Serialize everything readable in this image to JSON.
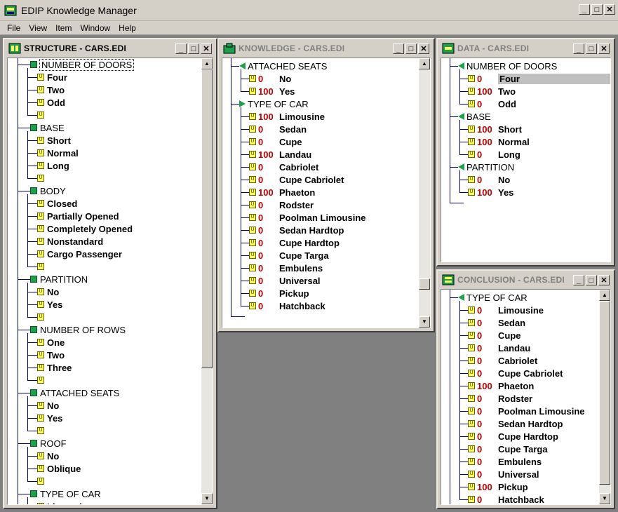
{
  "app": {
    "title": "EDIP Knowledge Manager",
    "menu": [
      "File",
      "View",
      "Item",
      "Window",
      "Help"
    ]
  },
  "structure": {
    "title": "STRUCTURE - CARS.EDI",
    "items": [
      {
        "kind": "group",
        "label": "NUMBER OF DOORS"
      },
      {
        "kind": "value",
        "label": "Four"
      },
      {
        "kind": "value",
        "label": "Two"
      },
      {
        "kind": "value",
        "label": "Odd"
      },
      {
        "kind": "value",
        "label": ""
      },
      {
        "kind": "group",
        "label": "BASE"
      },
      {
        "kind": "value",
        "label": "Short"
      },
      {
        "kind": "value",
        "label": "Normal"
      },
      {
        "kind": "value",
        "label": "Long"
      },
      {
        "kind": "value",
        "label": ""
      },
      {
        "kind": "group",
        "label": "BODY"
      },
      {
        "kind": "value",
        "label": "Closed"
      },
      {
        "kind": "value",
        "label": "Partially Opened"
      },
      {
        "kind": "value",
        "label": "Completely Opened"
      },
      {
        "kind": "value",
        "label": "Nonstandard"
      },
      {
        "kind": "value",
        "label": "Cargo Passenger"
      },
      {
        "kind": "value",
        "label": ""
      },
      {
        "kind": "group",
        "label": "PARTITION"
      },
      {
        "kind": "value",
        "label": "No"
      },
      {
        "kind": "value",
        "label": "Yes"
      },
      {
        "kind": "value",
        "label": ""
      },
      {
        "kind": "group",
        "label": "NUMBER OF ROWS"
      },
      {
        "kind": "value",
        "label": "One"
      },
      {
        "kind": "value",
        "label": "Two"
      },
      {
        "kind": "value",
        "label": "Three"
      },
      {
        "kind": "value",
        "label": ""
      },
      {
        "kind": "group",
        "label": "ATTACHED SEATS"
      },
      {
        "kind": "value",
        "label": "No"
      },
      {
        "kind": "value",
        "label": "Yes"
      },
      {
        "kind": "value",
        "label": ""
      },
      {
        "kind": "group",
        "label": "ROOF"
      },
      {
        "kind": "value",
        "label": "No"
      },
      {
        "kind": "value",
        "label": "Oblique"
      },
      {
        "kind": "value",
        "label": ""
      },
      {
        "kind": "group",
        "label": "TYPE OF CAR"
      },
      {
        "kind": "value",
        "label": "Limousine"
      }
    ]
  },
  "knowledge": {
    "title": "KNOWLEDGE - CARS.EDI",
    "groups": [
      {
        "label": "ATTACHED SEATS",
        "arrow": "left",
        "items": [
          {
            "num": "0",
            "label": "No"
          },
          {
            "num": "100",
            "label": "Yes"
          }
        ]
      },
      {
        "label": "TYPE OF CAR",
        "arrow": "right",
        "items": [
          {
            "num": "100",
            "label": "Limousine"
          },
          {
            "num": "0",
            "label": "Sedan"
          },
          {
            "num": "0",
            "label": "Cupe"
          },
          {
            "num": "100",
            "label": "Landau"
          },
          {
            "num": "0",
            "label": "Cabriolet"
          },
          {
            "num": "0",
            "label": "Cupe Cabriolet"
          },
          {
            "num": "100",
            "label": "Phaeton"
          },
          {
            "num": "0",
            "label": "Rodster"
          },
          {
            "num": "0",
            "label": "Poolman Limousine"
          },
          {
            "num": "0",
            "label": "Sedan Hardtop"
          },
          {
            "num": "0",
            "label": "Cupe Hardtop"
          },
          {
            "num": "0",
            "label": "Cupe Targa"
          },
          {
            "num": "0",
            "label": "Embulens"
          },
          {
            "num": "0",
            "label": "Universal"
          },
          {
            "num": "0",
            "label": "Pickup"
          },
          {
            "num": "0",
            "label": "Hatchback"
          }
        ]
      }
    ]
  },
  "data_win": {
    "title": "DATA - CARS.EDI",
    "groups": [
      {
        "label": "NUMBER OF DOORS",
        "arrow": "left",
        "items": [
          {
            "num": "0",
            "label": "Four",
            "selected": true
          },
          {
            "num": "100",
            "label": "Two"
          },
          {
            "num": "0",
            "label": "Odd"
          }
        ]
      },
      {
        "label": "BASE",
        "arrow": "left",
        "items": [
          {
            "num": "100",
            "label": "Short"
          },
          {
            "num": "100",
            "label": "Normal"
          },
          {
            "num": "0",
            "label": "Long"
          }
        ]
      },
      {
        "label": "PARTITION",
        "arrow": "left",
        "items": [
          {
            "num": "0",
            "label": "No"
          },
          {
            "num": "100",
            "label": "Yes"
          }
        ]
      }
    ]
  },
  "conclusion": {
    "title": "CONCLUSION - CARS.EDI",
    "groups": [
      {
        "label": "TYPE OF CAR",
        "arrow": "left",
        "items": [
          {
            "num": "0",
            "label": "Limousine"
          },
          {
            "num": "0",
            "label": "Sedan"
          },
          {
            "num": "0",
            "label": "Cupe"
          },
          {
            "num": "0",
            "label": "Landau"
          },
          {
            "num": "0",
            "label": "Cabriolet"
          },
          {
            "num": "0",
            "label": "Cupe Cabriolet"
          },
          {
            "num": "100",
            "label": "Phaeton"
          },
          {
            "num": "0",
            "label": "Rodster"
          },
          {
            "num": "0",
            "label": "Poolman Limousine"
          },
          {
            "num": "0",
            "label": "Sedan Hardtop"
          },
          {
            "num": "0",
            "label": "Cupe Hardtop"
          },
          {
            "num": "0",
            "label": "Cupe Targa"
          },
          {
            "num": "0",
            "label": "Embulens"
          },
          {
            "num": "0",
            "label": "Universal"
          },
          {
            "num": "100",
            "label": "Pickup"
          },
          {
            "num": "0",
            "label": "Hatchback"
          }
        ]
      }
    ]
  },
  "window_controls": {
    "minimize": "_",
    "maximize": "□",
    "close": "✕"
  },
  "icons": {
    "app": "edip-logo-icon",
    "value": "u-value-icon",
    "group": "green-square-icon",
    "arrow": "green-triangle-icon"
  }
}
